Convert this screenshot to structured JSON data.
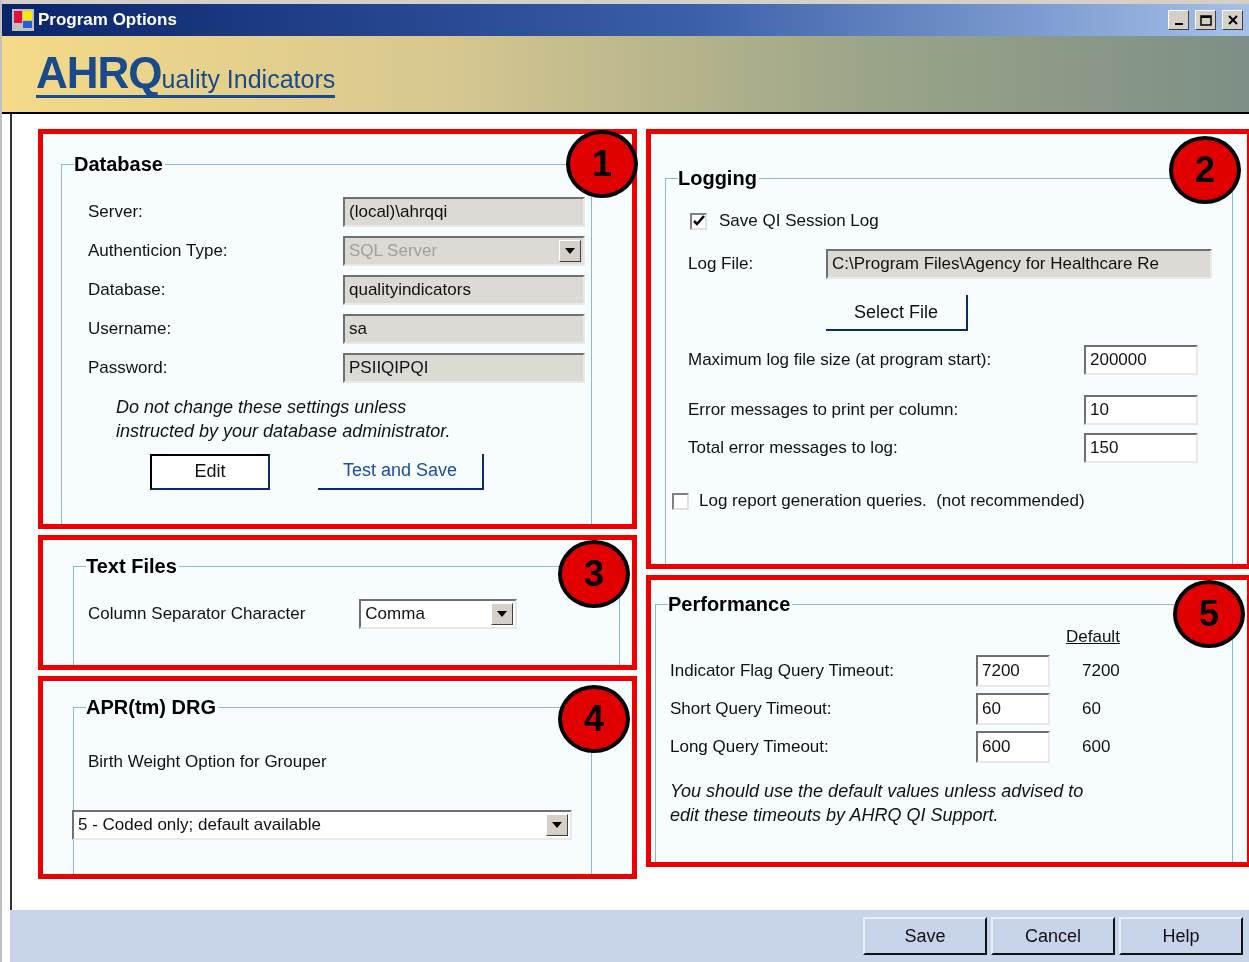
{
  "window": {
    "title": "Program Options"
  },
  "banner": {
    "logo_initials": "AHRQ",
    "logo_rest": "uality Indicators"
  },
  "database": {
    "number": "1",
    "title": "Database",
    "fields": [
      {
        "label": "Server:",
        "value": "(local)\\ahrqqi",
        "kind": "text",
        "disabled": false
      },
      {
        "label": "Authenticion Type:",
        "value": "SQL Server",
        "kind": "dropdown",
        "disabled": true
      },
      {
        "label": "Database:",
        "value": "qualityindicators",
        "kind": "text",
        "disabled": false
      },
      {
        "label": "Username:",
        "value": "sa",
        "kind": "text",
        "disabled": false
      },
      {
        "label": "Password:",
        "value": "PSIIQIPQI",
        "kind": "text",
        "disabled": false
      }
    ],
    "note": "Do not change these settings unless\ninstructed by your database administrator.",
    "buttons": [
      {
        "label": "Edit",
        "kind": "outlined"
      },
      {
        "label": "Test and Save",
        "kind": "flat"
      }
    ]
  },
  "logging": {
    "number": "2",
    "title": "Logging",
    "save_log": {
      "label": "Save QI Session Log",
      "checked": true
    },
    "log_file": {
      "label": "Log File:",
      "value": "C:\\Program Files\\Agency for Healthcare Re"
    },
    "select_button": "Select File",
    "numbers": [
      {
        "label": "Maximum log file size (at program start):",
        "value": "200000"
      },
      {
        "label": "Error messages to print per column:",
        "value": "10"
      },
      {
        "label": "Total error messages to log:",
        "value": "150"
      }
    ],
    "report_queries": {
      "label": "Log report generation queries.  (not recommended)",
      "checked": false
    }
  },
  "text_files": {
    "number": "3",
    "title": "Text Files",
    "label": "Column Separator Character",
    "value": "Comma"
  },
  "apr_drg": {
    "number": "4",
    "title": "APR(tm) DRG",
    "label": "Birth Weight Option for Grouper",
    "value": "5 - Coded only; default available"
  },
  "performance": {
    "number": "5",
    "title": "Performance",
    "default_heading": "Default",
    "rows": [
      {
        "label": "Indicator Flag Query Timeout:",
        "value": "7200",
        "default": "7200"
      },
      {
        "label": "Short Query Timeout:",
        "value": "60",
        "default": "60"
      },
      {
        "label": "Long Query Timeout:",
        "value": "600",
        "default": "600"
      }
    ],
    "note": "You should use the default values unless advised to\nedit these timeouts by AHRQ QI Support."
  },
  "footer_buttons": [
    "Save",
    "Cancel",
    "Help"
  ]
}
